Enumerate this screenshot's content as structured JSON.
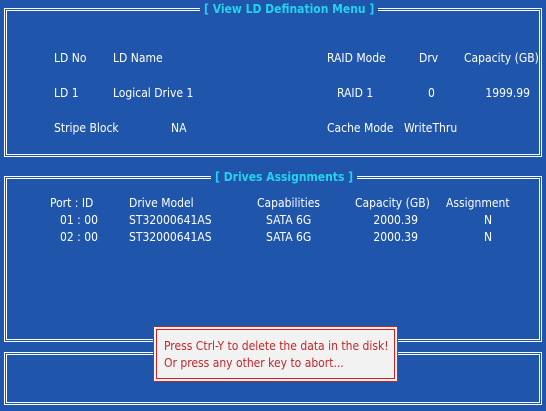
{
  "ld_panel": {
    "title": "[  View LD Defination Menu  ]",
    "headers": {
      "ld_no": "LD No",
      "ld_name": "LD Name",
      "raid_mode": "RAID Mode",
      "drv": "Drv",
      "capacity": "Capacity (GB)"
    },
    "row": {
      "ld_no": "LD   1",
      "ld_name": "Logical Drive 1",
      "raid_mode": "RAID 1",
      "drv": "0",
      "capacity": "1999.99"
    },
    "stripe_label": "Stripe Block",
    "stripe_value": "NA",
    "cache_label": "Cache Mode",
    "cache_value": "WriteThru"
  },
  "drives_panel": {
    "title": "[  Drives Assignments  ]",
    "headers": {
      "port": "Port : ID",
      "model": "Drive Model",
      "capabilities": "Capabilities",
      "capacity": "Capacity (GB)",
      "assignment": "Assignment"
    },
    "rows": [
      {
        "port": "01 : 00",
        "model": "ST32000641AS",
        "capabilities": "SATA  6G",
        "capacity": "2000.39",
        "assignment": "N"
      },
      {
        "port": "02 : 00",
        "model": "ST32000641AS",
        "capabilities": "SATA  6G",
        "capacity": "2000.39",
        "assignment": "N"
      }
    ]
  },
  "dialog": {
    "line1": "Press Ctrl-Y to delete the data in the disk!",
    "line2": "Or press any other key to abort..."
  },
  "colors": {
    "background": "#1f55aa",
    "title_accent": "#22d3ee",
    "dialog_text": "#c0282a",
    "dialog_border": "#cc2222"
  }
}
